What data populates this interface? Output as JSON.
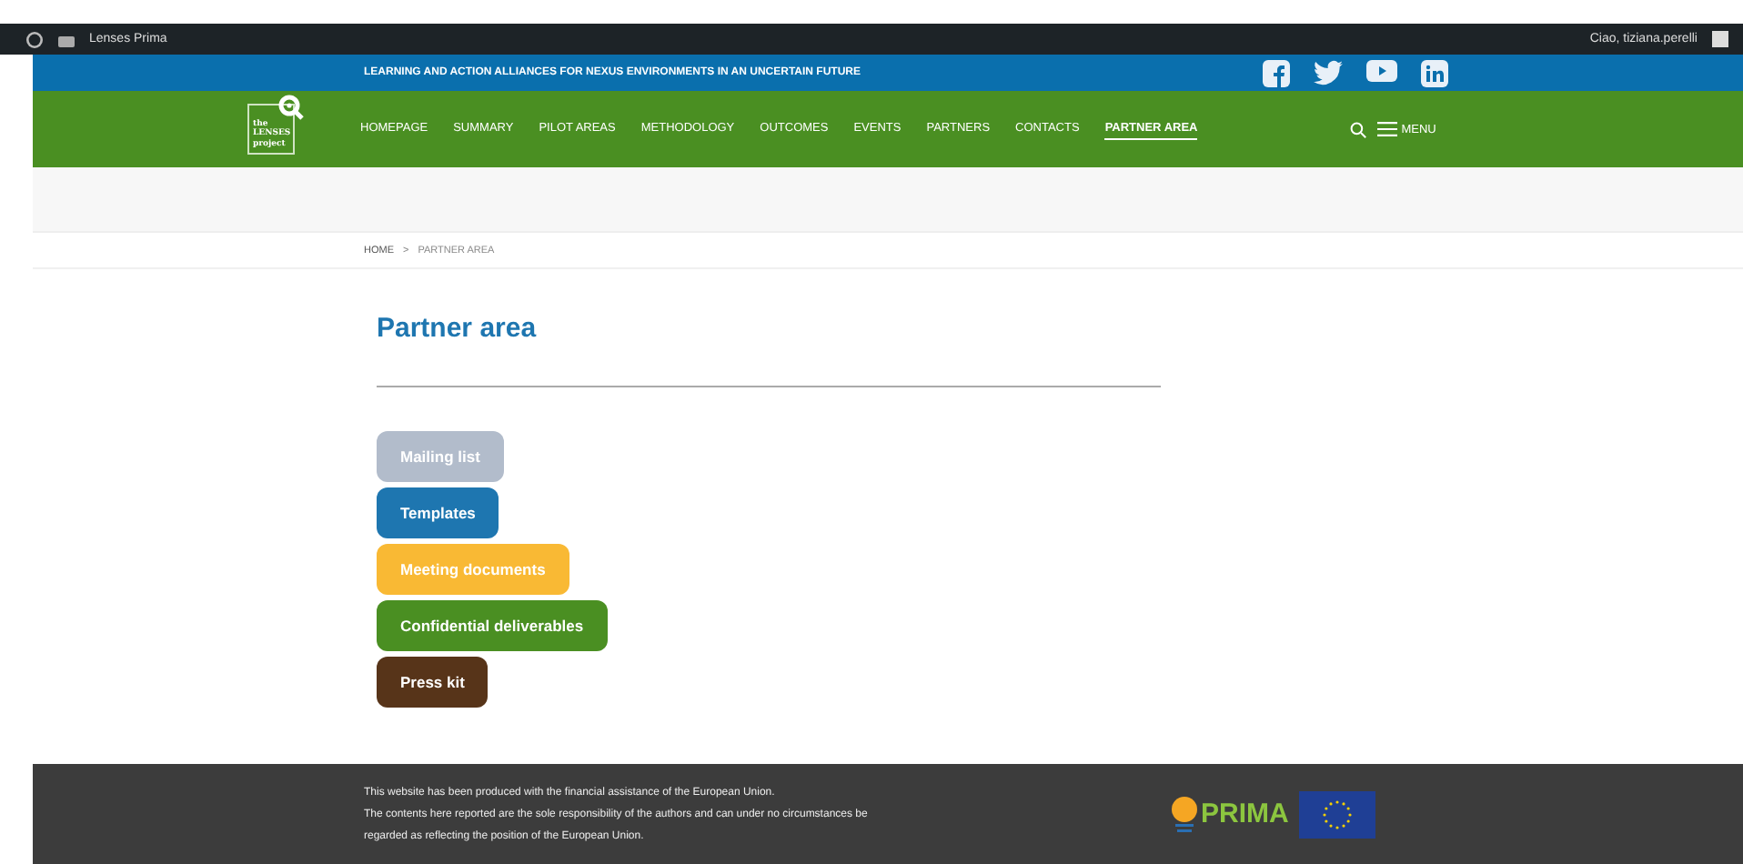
{
  "admin_bar": {
    "site_name": "Lenses Prima",
    "greeting": "Ciao, tiziana.perelli"
  },
  "top_bar": {
    "tagline": "LEARNING AND ACTION ALLIANCES FOR NEXUS ENVIRONMENTS IN AN UNCERTAIN FUTURE"
  },
  "logo": {
    "lines": [
      "the",
      "LENSES",
      "project"
    ]
  },
  "nav": {
    "items": [
      {
        "label": "HOMEPAGE",
        "selected": false
      },
      {
        "label": "SUMMARY",
        "selected": false
      },
      {
        "label": "PILOT AREAS",
        "selected": false
      },
      {
        "label": "METHODOLOGY",
        "selected": false
      },
      {
        "label": "OUTCOMES",
        "selected": false
      },
      {
        "label": "EVENTS",
        "selected": false
      },
      {
        "label": "PARTNERS",
        "selected": false
      },
      {
        "label": "CONTACTS",
        "selected": false
      },
      {
        "label": "PARTNER AREA",
        "selected": true
      }
    ],
    "menu_label": "MENU"
  },
  "breadcrumb": [
    "HOME",
    ">",
    "PARTNER AREA"
  ],
  "page_title": "Partner area",
  "buttons": [
    {
      "label": "Mailing list",
      "color": "#b2bccb"
    },
    {
      "label": "Templates",
      "color": "#1e76b0"
    },
    {
      "label": "Meeting documents",
      "color": "#f9b934"
    },
    {
      "label": "Confidential deliverables",
      "color": "#4a8f22"
    },
    {
      "label": "Press kit",
      "color": "#573419"
    }
  ],
  "footer": {
    "lines": [
      "This website has been produced with the financial assistance of the European Union.",
      "The contents here reported are the sole responsibility of the authors and can under no circumstances be",
      "regarded as reflecting the position of the European Union."
    ],
    "partner_logo": "PRIMA"
  }
}
